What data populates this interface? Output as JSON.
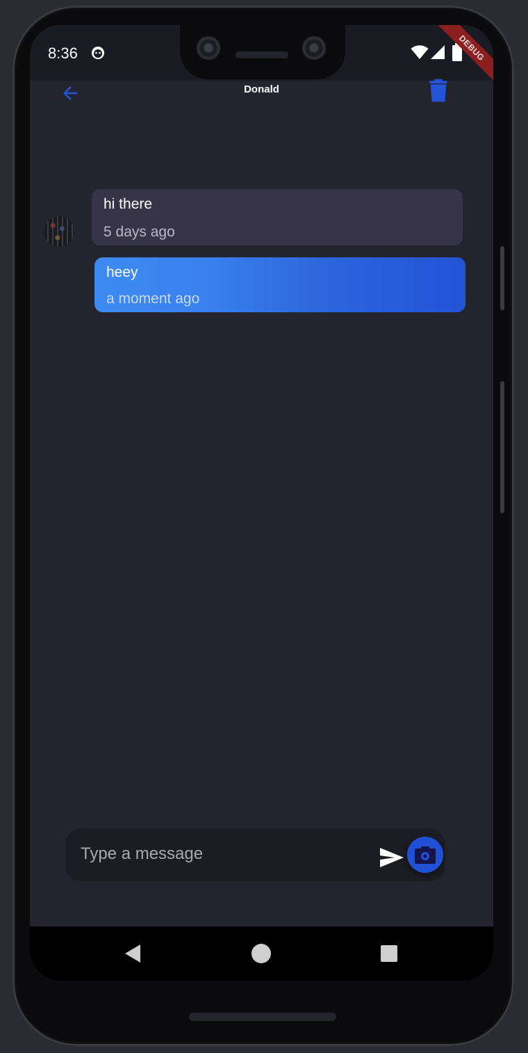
{
  "status_bar": {
    "time": "8:36",
    "debug_banner": "DEBUG"
  },
  "app_bar": {
    "title": "Donald",
    "back_icon": "arrow-back-icon",
    "delete_icon": "trash-icon"
  },
  "messages": [
    {
      "sender": "other",
      "text": "hi there",
      "time": "5 days ago"
    },
    {
      "sender": "me",
      "text": "heey",
      "time": "a moment ago"
    }
  ],
  "composer": {
    "placeholder": "Type a message",
    "value": "",
    "send_icon": "send-icon",
    "camera_icon": "camera-icon"
  },
  "colors": {
    "accent": "#2353d6",
    "background": "#24242f",
    "received_bubble": "#363446"
  }
}
